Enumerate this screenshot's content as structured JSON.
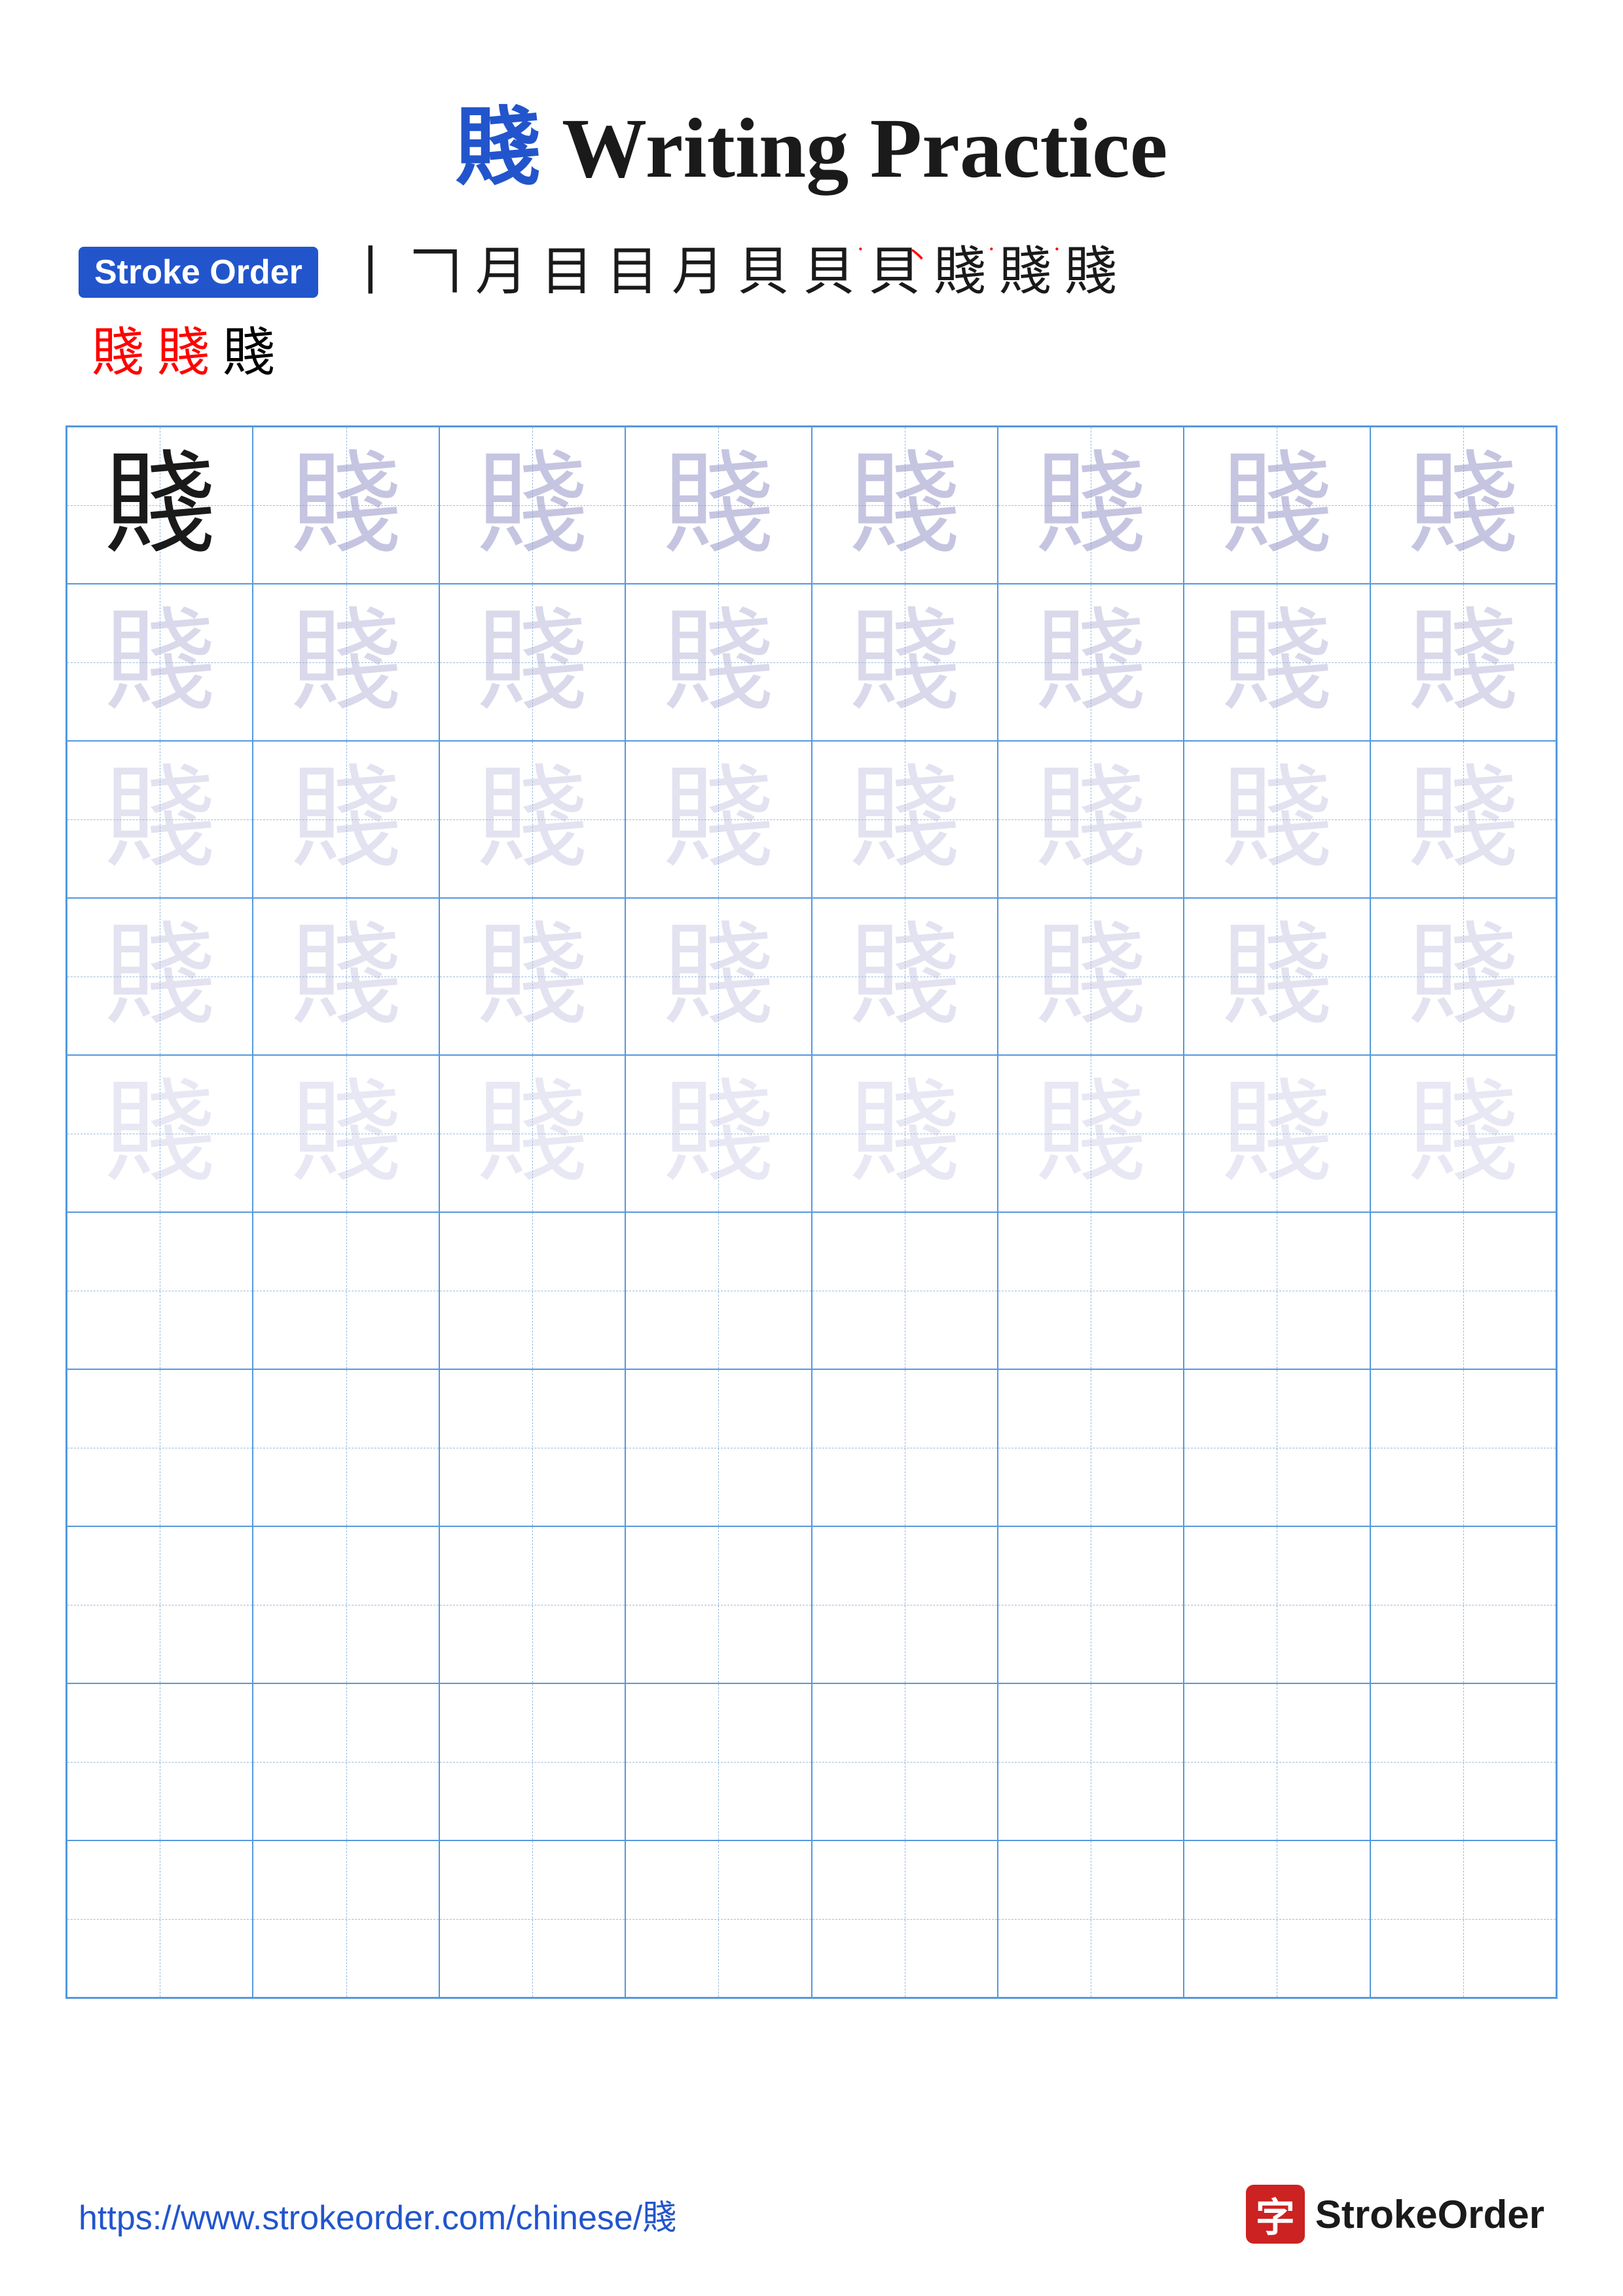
{
  "title": {
    "chinese": "賤",
    "english": " Writing Practice"
  },
  "stroke_order": {
    "badge": "Stroke Order",
    "strokes": [
      "丨",
      "𠃍",
      "月",
      "目",
      "目",
      "月",
      "貝",
      "貝˙",
      "貝丶",
      "賤˙",
      "賤˙",
      "賤"
    ],
    "row2": [
      "賤",
      "賤",
      "賤"
    ]
  },
  "character": "賤",
  "grid": {
    "cols": 8,
    "rows": 10,
    "filled_rows": 5
  },
  "footer": {
    "url": "https://www.strokeorder.com/chinese/賤",
    "logo_char": "字",
    "logo_text": "StrokeOrder"
  }
}
